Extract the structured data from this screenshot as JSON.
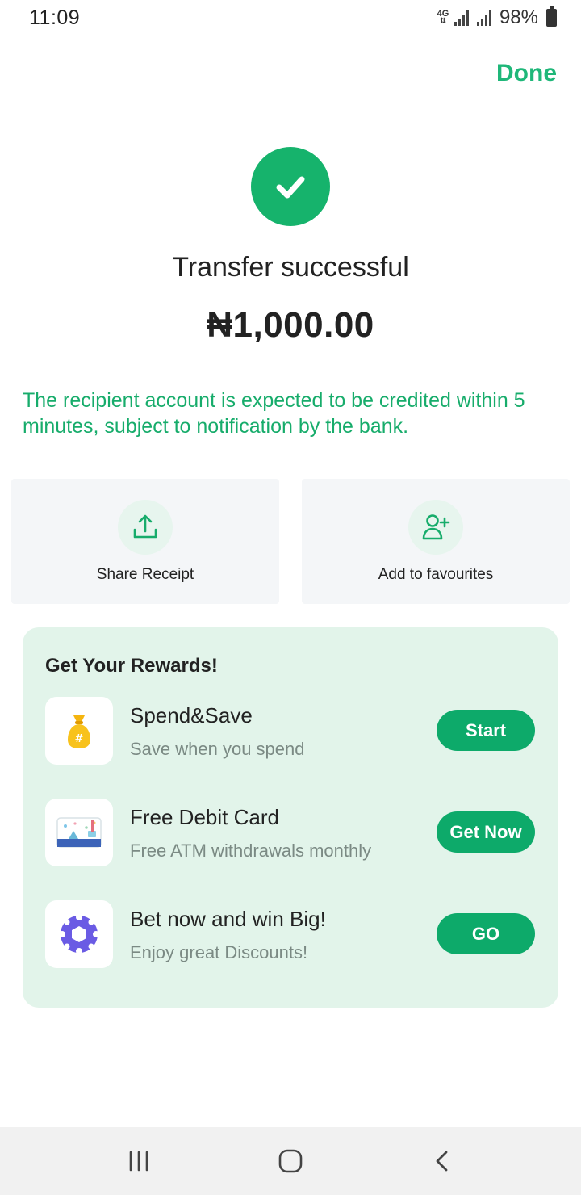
{
  "status_bar": {
    "time": "11:09",
    "network": "4G",
    "battery": "98%"
  },
  "header": {
    "done_label": "Done"
  },
  "result": {
    "title": "Transfer successful",
    "amount": "₦1,000.00",
    "notice": "The recipient account is expected to be credited within 5 minutes, subject to notification by the bank."
  },
  "actions": [
    {
      "label": "Share Receipt",
      "icon": "share-upload-icon"
    },
    {
      "label": "Add to favourites",
      "icon": "add-user-icon"
    }
  ],
  "rewards": {
    "title": "Get Your Rewards!",
    "items": [
      {
        "title": "Spend&Save",
        "subtitle": "Save when you spend",
        "button": "Start",
        "icon": "money-bag-icon"
      },
      {
        "title": "Free Debit Card",
        "subtitle": "Free ATM withdrawals monthly",
        "button": "Get Now",
        "icon": "debit-card-icon"
      },
      {
        "title": "Bet now and win Big!",
        "subtitle": "Enjoy great Discounts!",
        "button": "GO",
        "icon": "poker-chip-icon"
      }
    ]
  },
  "colors": {
    "accent": "#16b36c",
    "button": "#0daa6a",
    "rewards_bg": "#e2f4ea",
    "card_bg": "#f4f6f8"
  },
  "nav": {
    "icons": [
      "recent-apps-icon",
      "home-icon",
      "back-icon"
    ]
  }
}
